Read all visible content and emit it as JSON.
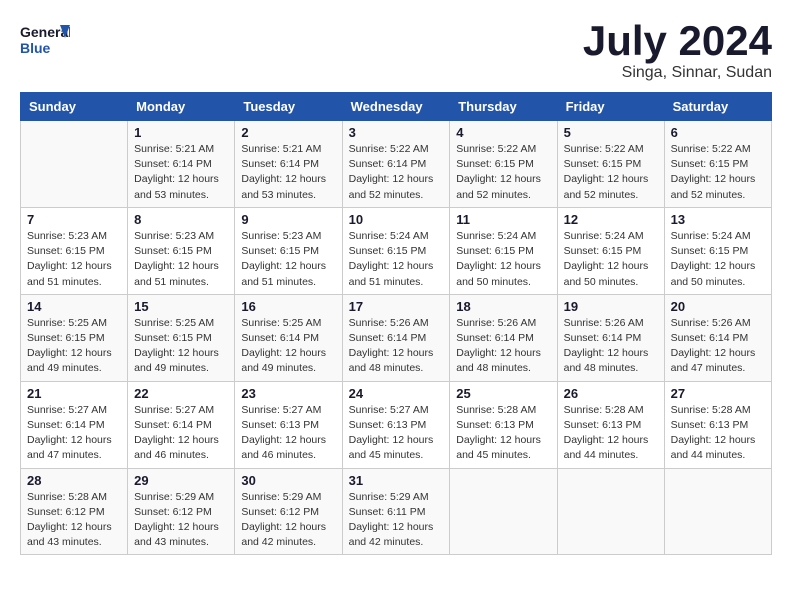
{
  "header": {
    "logo_line1": "General",
    "logo_line2": "Blue",
    "month": "July 2024",
    "location": "Singa, Sinnar, Sudan"
  },
  "days_of_week": [
    "Sunday",
    "Monday",
    "Tuesday",
    "Wednesday",
    "Thursday",
    "Friday",
    "Saturday"
  ],
  "weeks": [
    [
      {
        "num": "",
        "info": ""
      },
      {
        "num": "1",
        "info": "Sunrise: 5:21 AM\nSunset: 6:14 PM\nDaylight: 12 hours\nand 53 minutes."
      },
      {
        "num": "2",
        "info": "Sunrise: 5:21 AM\nSunset: 6:14 PM\nDaylight: 12 hours\nand 53 minutes."
      },
      {
        "num": "3",
        "info": "Sunrise: 5:22 AM\nSunset: 6:14 PM\nDaylight: 12 hours\nand 52 minutes."
      },
      {
        "num": "4",
        "info": "Sunrise: 5:22 AM\nSunset: 6:15 PM\nDaylight: 12 hours\nand 52 minutes."
      },
      {
        "num": "5",
        "info": "Sunrise: 5:22 AM\nSunset: 6:15 PM\nDaylight: 12 hours\nand 52 minutes."
      },
      {
        "num": "6",
        "info": "Sunrise: 5:22 AM\nSunset: 6:15 PM\nDaylight: 12 hours\nand 52 minutes."
      }
    ],
    [
      {
        "num": "7",
        "info": "Sunrise: 5:23 AM\nSunset: 6:15 PM\nDaylight: 12 hours\nand 51 minutes."
      },
      {
        "num": "8",
        "info": "Sunrise: 5:23 AM\nSunset: 6:15 PM\nDaylight: 12 hours\nand 51 minutes."
      },
      {
        "num": "9",
        "info": "Sunrise: 5:23 AM\nSunset: 6:15 PM\nDaylight: 12 hours\nand 51 minutes."
      },
      {
        "num": "10",
        "info": "Sunrise: 5:24 AM\nSunset: 6:15 PM\nDaylight: 12 hours\nand 51 minutes."
      },
      {
        "num": "11",
        "info": "Sunrise: 5:24 AM\nSunset: 6:15 PM\nDaylight: 12 hours\nand 50 minutes."
      },
      {
        "num": "12",
        "info": "Sunrise: 5:24 AM\nSunset: 6:15 PM\nDaylight: 12 hours\nand 50 minutes."
      },
      {
        "num": "13",
        "info": "Sunrise: 5:24 AM\nSunset: 6:15 PM\nDaylight: 12 hours\nand 50 minutes."
      }
    ],
    [
      {
        "num": "14",
        "info": "Sunrise: 5:25 AM\nSunset: 6:15 PM\nDaylight: 12 hours\nand 49 minutes."
      },
      {
        "num": "15",
        "info": "Sunrise: 5:25 AM\nSunset: 6:15 PM\nDaylight: 12 hours\nand 49 minutes."
      },
      {
        "num": "16",
        "info": "Sunrise: 5:25 AM\nSunset: 6:14 PM\nDaylight: 12 hours\nand 49 minutes."
      },
      {
        "num": "17",
        "info": "Sunrise: 5:26 AM\nSunset: 6:14 PM\nDaylight: 12 hours\nand 48 minutes."
      },
      {
        "num": "18",
        "info": "Sunrise: 5:26 AM\nSunset: 6:14 PM\nDaylight: 12 hours\nand 48 minutes."
      },
      {
        "num": "19",
        "info": "Sunrise: 5:26 AM\nSunset: 6:14 PM\nDaylight: 12 hours\nand 48 minutes."
      },
      {
        "num": "20",
        "info": "Sunrise: 5:26 AM\nSunset: 6:14 PM\nDaylight: 12 hours\nand 47 minutes."
      }
    ],
    [
      {
        "num": "21",
        "info": "Sunrise: 5:27 AM\nSunset: 6:14 PM\nDaylight: 12 hours\nand 47 minutes."
      },
      {
        "num": "22",
        "info": "Sunrise: 5:27 AM\nSunset: 6:14 PM\nDaylight: 12 hours\nand 46 minutes."
      },
      {
        "num": "23",
        "info": "Sunrise: 5:27 AM\nSunset: 6:13 PM\nDaylight: 12 hours\nand 46 minutes."
      },
      {
        "num": "24",
        "info": "Sunrise: 5:27 AM\nSunset: 6:13 PM\nDaylight: 12 hours\nand 45 minutes."
      },
      {
        "num": "25",
        "info": "Sunrise: 5:28 AM\nSunset: 6:13 PM\nDaylight: 12 hours\nand 45 minutes."
      },
      {
        "num": "26",
        "info": "Sunrise: 5:28 AM\nSunset: 6:13 PM\nDaylight: 12 hours\nand 44 minutes."
      },
      {
        "num": "27",
        "info": "Sunrise: 5:28 AM\nSunset: 6:13 PM\nDaylight: 12 hours\nand 44 minutes."
      }
    ],
    [
      {
        "num": "28",
        "info": "Sunrise: 5:28 AM\nSunset: 6:12 PM\nDaylight: 12 hours\nand 43 minutes."
      },
      {
        "num": "29",
        "info": "Sunrise: 5:29 AM\nSunset: 6:12 PM\nDaylight: 12 hours\nand 43 minutes."
      },
      {
        "num": "30",
        "info": "Sunrise: 5:29 AM\nSunset: 6:12 PM\nDaylight: 12 hours\nand 42 minutes."
      },
      {
        "num": "31",
        "info": "Sunrise: 5:29 AM\nSunset: 6:11 PM\nDaylight: 12 hours\nand 42 minutes."
      },
      {
        "num": "",
        "info": ""
      },
      {
        "num": "",
        "info": ""
      },
      {
        "num": "",
        "info": ""
      }
    ]
  ]
}
